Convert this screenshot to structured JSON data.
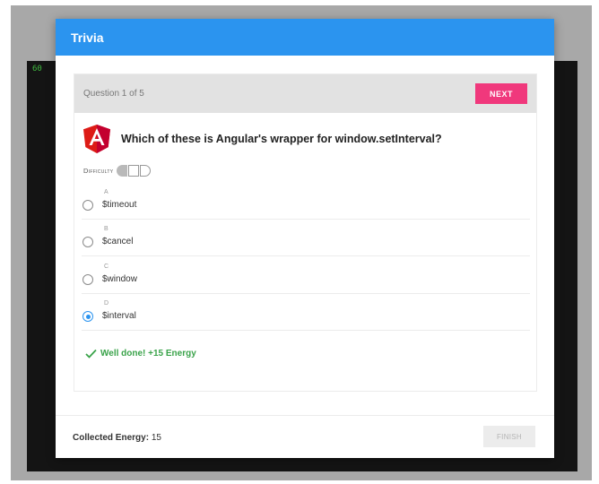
{
  "app": {
    "fps_counter": "60"
  },
  "dialog": {
    "title": "Trivia",
    "question_counter": "Question 1 of 5",
    "next_label": "NEXT",
    "question_text": "Which of these is Angular's wrapper for window.setInterval?",
    "question_icon": "angular-logo-icon",
    "difficulty_label": "Difficulty",
    "difficulty": {
      "level": 1,
      "max": 3
    },
    "answers": [
      {
        "letter": "A",
        "text": "$timeout",
        "selected": false
      },
      {
        "letter": "B",
        "text": "$cancel",
        "selected": false
      },
      {
        "letter": "C",
        "text": "$window",
        "selected": false
      },
      {
        "letter": "D",
        "text": "$interval",
        "selected": true
      }
    ],
    "feedback": "Well done! +15 Energy",
    "feedback_icon": "checkmark-icon",
    "collected_energy_label": "Collected Energy:",
    "collected_energy_value": "15",
    "finish_label": "FINISH"
  },
  "colors": {
    "header": "#2b94ef",
    "next_button": "#f0387c",
    "success": "#3aa34a",
    "angular_red": "#dd1b16"
  }
}
